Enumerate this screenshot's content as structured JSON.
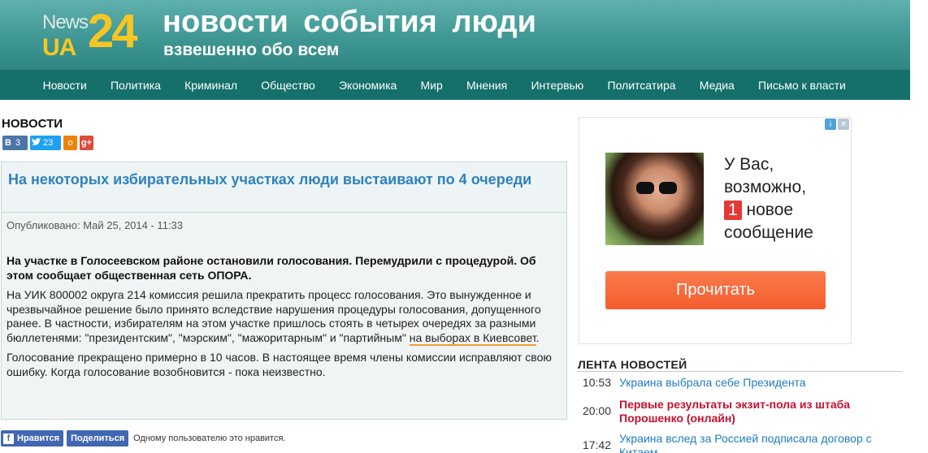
{
  "header": {
    "logo": {
      "news": "News",
      "ua": "UA",
      "num": "24"
    },
    "title": "новости  события  люди",
    "subtitle": "взвешенно обо всем"
  },
  "nav": [
    "Новости",
    "Политика",
    "Криминал",
    "Общество",
    "Экономика",
    "Мир",
    "Мнения",
    "Интервью",
    "Политсатира",
    "Медиа",
    "Письмо к власти"
  ],
  "section_title": "НОВОСТИ",
  "share": {
    "vk_icon": "B",
    "vk_count": "3",
    "tw_count": "23",
    "ok_icon": "o",
    "gp_icon": "g+"
  },
  "article": {
    "title": "На некоторых избирательных участках люди выстаивают по 4 очереди",
    "published": "Опубликовано: Май 25, 2014 - 11:33",
    "lead": "На участке в Голосеевском районе остановили голосования. Перемудрили с процедурой. Об этом сообщает общественная сеть ОПОРА.",
    "para1": "На УИК 800002 округа 214 комиссия решила прекратить процесс голосования. Это вынужденное и чрезвычайное решение было принято вследствие нарушения процедуры голосования, допущенного ранее. В частности, избирателям на этом участке пришлось стоять в четырех очередях за разными бюллетенями: \"президентским\", \"мэрским\", \"мажоритарным\" и \"партийным\" ",
    "para1_link": "на выборах в Киевсовет",
    "para1_end": ".",
    "para2": "Голосование прекращено примерно в 10 часов. В настоящее время члены комиссии исправляют свою ошибку. Когда голосование возобновится - пока неизвестно."
  },
  "facebook": {
    "icon": "f",
    "like_label": "Нравится",
    "share_label": "Поделиться",
    "text": "Одному пользователю это нравится."
  },
  "ad": {
    "info_icon": "i",
    "close_icon": "✕",
    "line1": "У Вас,",
    "line2": "возможно,",
    "badge": "1",
    "line3": " новое",
    "line4": "сообщение",
    "button": "Прочитать"
  },
  "feed": {
    "title": "ЛЕНТА НОВОСТЕЙ",
    "items": [
      {
        "time": "10:53",
        "text": "Украина выбрала себе Президента",
        "hot": false
      },
      {
        "time": "20:00",
        "text": "Первые результаты экзит-пола из штаба Порошенко (онлайн)",
        "hot": true
      },
      {
        "time": "17:42",
        "text": "Украина вслед за Россией подписала договор с Китаем",
        "hot": false
      }
    ]
  },
  "colors": {
    "header_bg": "#3f9793",
    "nav_bg": "#15706b",
    "logo_yellow": "#f7c623",
    "title_link": "#2e82c0",
    "feed_hot": "#c8102e",
    "ad_button": "#f45d2f"
  }
}
